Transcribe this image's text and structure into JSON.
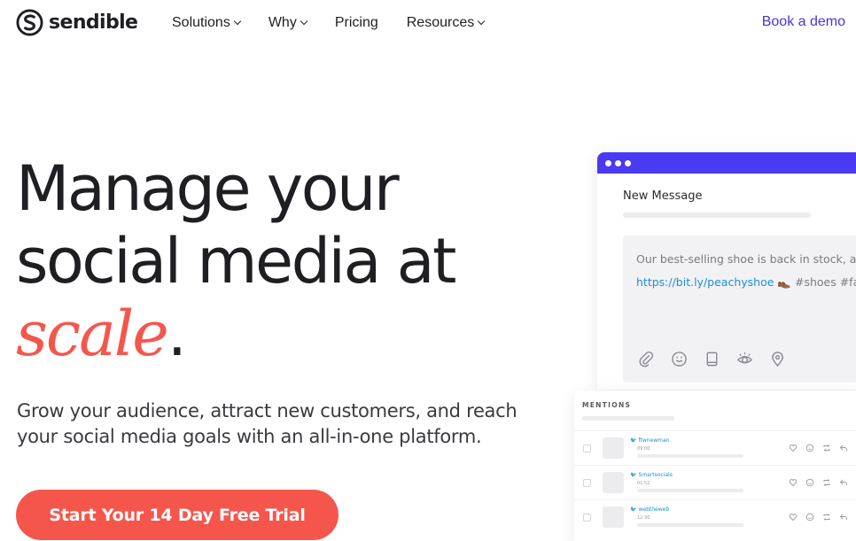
{
  "brand": {
    "name": "sendible",
    "logo_icon": "sendible-s-logo-icon"
  },
  "nav": {
    "items": [
      {
        "label": "Solutions",
        "has_dropdown": true
      },
      {
        "label": "Why",
        "has_dropdown": true
      },
      {
        "label": "Pricing",
        "has_dropdown": false
      },
      {
        "label": "Resources",
        "has_dropdown": true
      }
    ],
    "demo_label": "Book a demo"
  },
  "hero": {
    "line1": "Manage your",
    "line2": "social media at",
    "accent_word": "scale",
    "period": ".",
    "subtitle": "Grow your audience, attract new customers, and reach your social media goals with an all-in-one platform.",
    "cta_label": "Start Your 14 Day Free Trial"
  },
  "composer": {
    "title": "New Message",
    "text_line1": "Our best-selling shoe is back in stock, av",
    "link": "https://bit.ly/peachyshoe",
    "emoji": "👞",
    "hashtags": "#shoes #fa",
    "tools": [
      "paperclip-icon",
      "smiley-icon",
      "book-icon",
      "eye-icon",
      "location-pin-icon"
    ]
  },
  "mentions": {
    "title": "MENTIONS",
    "rows": [
      {
        "handle": "ftwnewman",
        "time": "09:00"
      },
      {
        "handle": "Smartsocials",
        "time": "01:52"
      },
      {
        "handle": "webtheweb",
        "time": "12:30"
      }
    ]
  },
  "colors": {
    "accent": "#f5564c",
    "brand_purple": "#4a3af2",
    "link_blue": "#1a8fd6",
    "nav_demo": "#4636d9",
    "text": "#1f1f23"
  }
}
